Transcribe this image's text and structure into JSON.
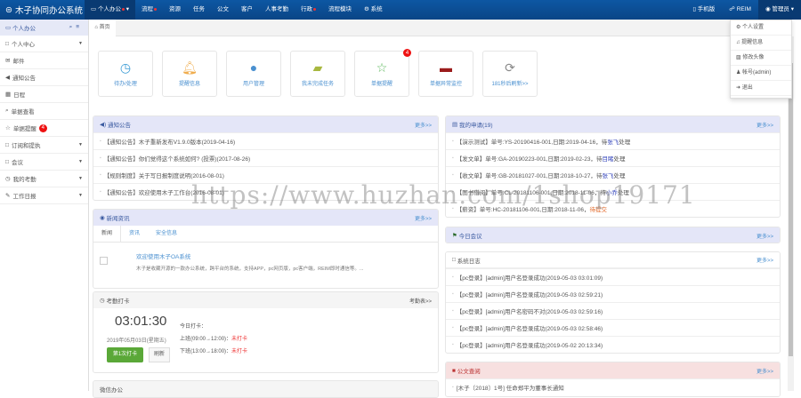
{
  "app": {
    "title": "木子协同办公系统"
  },
  "nav": [
    {
      "label": "个人办公",
      "dot": true
    },
    {
      "label": "流程",
      "dot": true
    },
    {
      "label": "资源"
    },
    {
      "label": "任务"
    },
    {
      "label": "公文"
    },
    {
      "label": "客户"
    },
    {
      "label": "人事考勤"
    },
    {
      "label": "行政",
      "dot": true
    },
    {
      "label": "流程模块"
    },
    {
      "label": "系统"
    }
  ],
  "topright": {
    "mobile": "手机版",
    "reim": "REIM",
    "user": "管理员"
  },
  "user_menu": [
    "个人设置",
    "提醒信息",
    "修改头像",
    "帐号(admin)",
    "退出"
  ],
  "sidebar": {
    "title": "个人办公",
    "items": [
      {
        "label": "个人中心",
        "icon": "□",
        "caret": true
      },
      {
        "label": "邮件",
        "icon": "✉"
      },
      {
        "label": "通知公告",
        "icon": "◀"
      },
      {
        "label": "日程",
        "icon": "▦"
      },
      {
        "label": "单据查看",
        "icon": "⌕"
      },
      {
        "label": "单据提醒",
        "icon": "☆",
        "badge": "4"
      },
      {
        "label": "订阅和提执",
        "icon": "□",
        "caret": true
      },
      {
        "label": "会议",
        "icon": "□",
        "caret": true
      },
      {
        "label": "我的考勤",
        "icon": "◷",
        "caret": true
      },
      {
        "label": "工作日报",
        "icon": "✎",
        "caret": true
      }
    ]
  },
  "tab": "首页",
  "quick": [
    {
      "label": "待办/处理",
      "icon": "◷",
      "color": "#3a9bd5"
    },
    {
      "label": "提醒信息",
      "icon": "🔔︎",
      "color": "#f0ad4e"
    },
    {
      "label": "用户管理",
      "icon": "●",
      "color": "#4a90d0"
    },
    {
      "label": "我未完成任务",
      "icon": "▰",
      "color": "#a8b840"
    },
    {
      "label": "单据提醒",
      "icon": "☆",
      "color": "#5cb85c",
      "badge": "4"
    },
    {
      "label": "单据异常监控",
      "icon": "▬",
      "color": "#9b1c1c"
    },
    {
      "label": "181秒后刷新>>",
      "icon": "⟳",
      "color": "#888"
    }
  ],
  "more": "更多>>",
  "notice": {
    "title": "通知公告",
    "rows": [
      "【通知公告】木子重新发布V1.9.0版本(2019-04-16)",
      "【通知公告】你们觉得这个系统如何? (投票)(2017-08-26)",
      "【规则制度】关于写日报制度说明(2016-08-01)",
      "【通知公告】欢迎使用木子工作台(2016-08-01)"
    ]
  },
  "news": {
    "title": "新闻资讯",
    "tabs": [
      "新闻",
      "资讯",
      "安全信息"
    ],
    "headline": "欢迎使用木子OA系统",
    "summary": "木子是收藏开源的一款办公系统，跨平台的系统，支持APP，pc网页版，pc客户端，REIM即时通信等。..."
  },
  "attendance": {
    "title": "考勤打卡",
    "link": "考勤表>>",
    "time": "03:01:30",
    "date": "2019年05月03日(星期五)",
    "today": "今日打卡：",
    "am": "上班(09:00→12:00)：",
    "pm": "下班(13:00→18:00)：",
    "status": "未打卡",
    "punch": "第1次打卡",
    "refresh": "刷新"
  },
  "wechat": {
    "title": "微信办公"
  },
  "apply": {
    "title": "我的申请(19)",
    "rows": [
      {
        "text": "【演示测试】单号:YS-20190416-001,日期:2019-04-16，",
        "pre": "待",
        "who": "张飞",
        "post": "处理"
      },
      {
        "text": "【发文单】单号:GA-20190223-001,日期:2019-02-23，",
        "pre": "待",
        "who": "目睹",
        "post": "处理"
      },
      {
        "text": "【收文单】单号:GB-20181027-001,日期:2018-10-27，",
        "pre": "待",
        "who": "张飞",
        "post": "处理"
      },
      {
        "text": "【图书借阅】单号:CL-20181106-001,日期:2018-11-06，",
        "pre": "待",
        "who": "小乔",
        "post": "处理"
      },
      {
        "text": "【薪资】单号:HC-20181106-001,日期:2018-11-06，",
        "pre": "",
        "who": "",
        "post": "待提交",
        "orange": true
      }
    ]
  },
  "meeting": {
    "title": "今日会议"
  },
  "syslog": {
    "title": "系统日志",
    "rows": [
      "【pc登录】[admin]用户名登录成功(2019-05-03 03:01:09)",
      "【pc登录】[admin]用户名登录成功(2019-05-03 02:59:21)",
      "【pc登录】[admin]用户名密码不对(2019-05-03 02:59:16)",
      "【pc登录】[admin]用户名登录成功(2019-05-03 02:58:46)",
      "【pc登录】[admin]用户名登录成功(2019-05-02 20:13:34)"
    ]
  },
  "docs": {
    "title": "公文查阅",
    "rows": [
      "[木子〔2018〕1号] 任命郑平为董事长通知"
    ]
  },
  "watermark": "https://www.huzhan.com/1shop19171"
}
